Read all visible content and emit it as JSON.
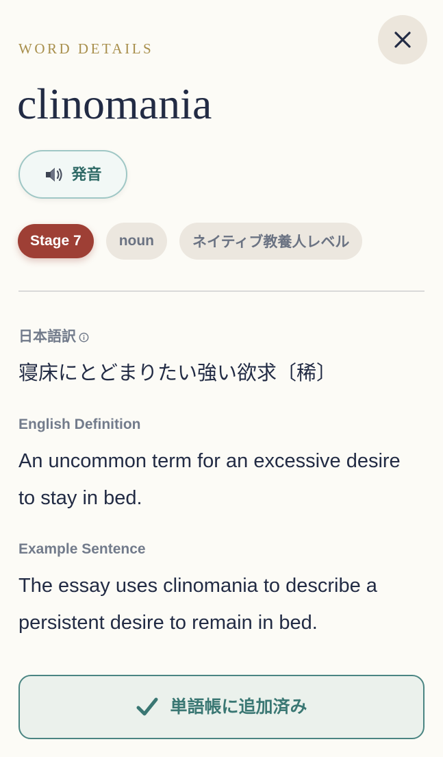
{
  "header": {
    "kicker": "WORD DETAILS",
    "close_icon": "close-icon"
  },
  "word": {
    "term": "clinomania"
  },
  "pronunciation": {
    "icon": "speaker-icon",
    "label": "発音"
  },
  "chips": {
    "stage": "Stage 7",
    "part_of_speech": "noun",
    "level": "ネイティブ教養人レベル"
  },
  "sections": {
    "japanese": {
      "label": "日本語訳",
      "info_icon": "info-icon",
      "text": "寝床にとどまりたい強い欲求〔稀〕"
    },
    "definition": {
      "label": "English Definition",
      "text": "An uncommon term for an excessive desire to stay in bed."
    },
    "example": {
      "label": "Example Sentence",
      "text": "The essay uses clinomania to describe a persistent desire to remain in bed."
    }
  },
  "footer": {
    "added_icon": "check-icon",
    "added_label": "単語帳に追加済み"
  },
  "colors": {
    "background": "#fcfbf6",
    "accent_gold": "#a88f4c",
    "stage_red": "#9e3f35",
    "teal": "#3a7773",
    "text_dark": "#222b44",
    "label_gray": "#727b8b"
  }
}
